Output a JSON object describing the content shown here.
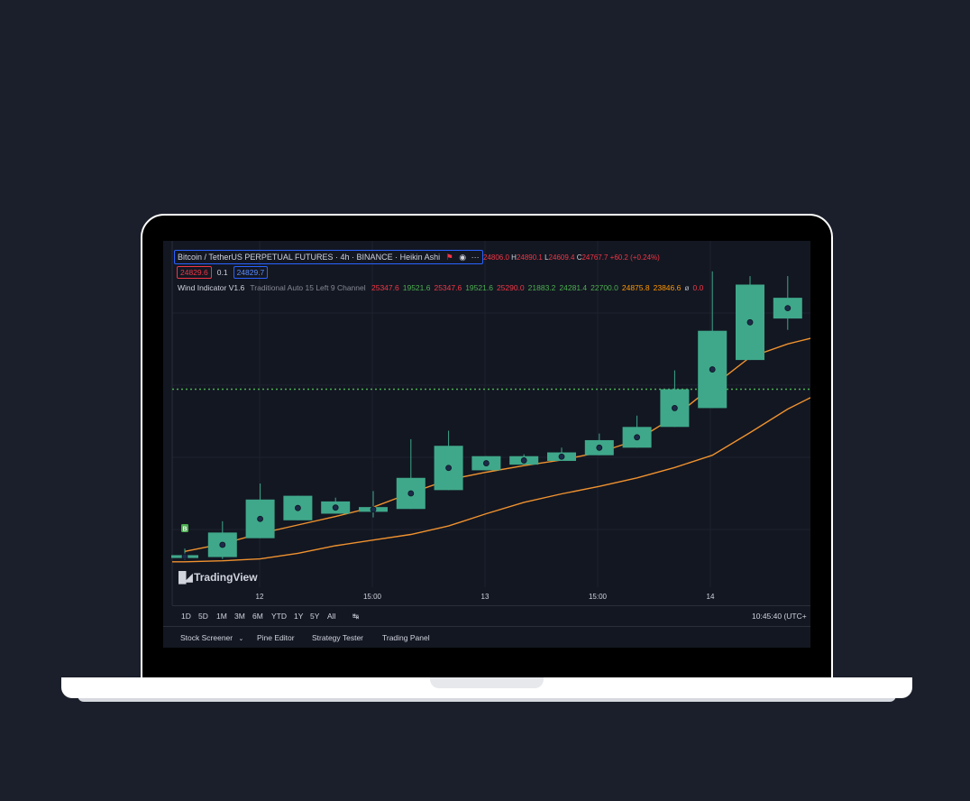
{
  "symbol_title": "Bitcoin / TetherUS PERPETUAL FUTURES · 4h · BINANCE · Heikin Ashi",
  "ohlc": {
    "o_val": "24806.0",
    "h_label": "H",
    "h_val": "24890.1",
    "l_label": "L",
    "l_val": "24609.4",
    "c_label": "C",
    "c_val": "24767.7",
    "change": "+60.2 (+0.24%)"
  },
  "price_tags": {
    "sell": "24829.6",
    "spread": "0.1",
    "buy": "24829.7"
  },
  "indicator": {
    "name": "Wind Indicator V1.6",
    "params": "Traditional Auto 15 Left 9 Channel",
    "values": [
      {
        "text": "25347.6",
        "color": "#f23645"
      },
      {
        "text": "19521.6",
        "color": "#4caf50"
      },
      {
        "text": "25347.6",
        "color": "#f23645"
      },
      {
        "text": "19521.6",
        "color": "#4caf50"
      },
      {
        "text": "25290.0",
        "color": "#f23645"
      },
      {
        "text": "21883.2",
        "color": "#4caf50"
      },
      {
        "text": "24281.4",
        "color": "#4caf50"
      },
      {
        "text": "22700.0",
        "color": "#4caf50"
      },
      {
        "text": "24875.8",
        "color": "#ff9800"
      },
      {
        "text": "23846.6",
        "color": "#ff9800"
      },
      {
        "text": "ø",
        "color": "#b2b5be"
      },
      {
        "text": "0.0",
        "color": "#f23645"
      }
    ]
  },
  "watermark": "TradingView",
  "buy_marker": "B",
  "x_axis_labels": [
    "12",
    "15:00",
    "13",
    "15:00",
    "14"
  ],
  "timeframes": [
    "1D",
    "5D",
    "1M",
    "3M",
    "6M",
    "YTD",
    "1Y",
    "5Y",
    "All"
  ],
  "clock": "10:45:40 (UTC+",
  "bottom_tabs": [
    "Stock Screener",
    "Pine Editor",
    "Strategy Tester",
    "Trading Panel"
  ],
  "colors": {
    "background": "#131722",
    "candle_up": "#3fa88a",
    "orange_line": "#f0922f",
    "green_dotted": "#4caf50",
    "grid": "#1e222d"
  },
  "chart_data": {
    "type": "candlestick",
    "style": "Heikin Ashi",
    "x_ticks": [
      "12",
      "15:00",
      "13",
      "15:00",
      "14"
    ],
    "candles": [
      {
        "open": 23610,
        "close": 23640,
        "high": 23710,
        "low": 23590
      },
      {
        "open": 23620,
        "close": 23880,
        "high": 24000,
        "low": 23600
      },
      {
        "open": 23820,
        "close": 24230,
        "high": 24400,
        "low": 23820
      },
      {
        "open": 24010,
        "close": 24270,
        "high": 24270,
        "low": 24010
      },
      {
        "open": 24080,
        "close": 24210,
        "high": 24250,
        "low": 24080
      },
      {
        "open": 24100,
        "close": 24150,
        "high": 24320,
        "low": 24040
      },
      {
        "open": 24130,
        "close": 24460,
        "high": 24870,
        "low": 24130
      },
      {
        "open": 24330,
        "close": 24800,
        "high": 24960,
        "low": 24330
      },
      {
        "open": 24540,
        "close": 24690,
        "high": 24690,
        "low": 24540
      },
      {
        "open": 24600,
        "close": 24690,
        "high": 24710,
        "low": 24600
      },
      {
        "open": 24640,
        "close": 24730,
        "high": 24780,
        "low": 24640
      },
      {
        "open": 24700,
        "close": 24860,
        "high": 24930,
        "low": 24700
      },
      {
        "open": 24780,
        "close": 25000,
        "high": 25120,
        "low": 24780
      },
      {
        "open": 25000,
        "close": 25400,
        "high": 25600,
        "low": 25000
      },
      {
        "open": 25200,
        "close": 26020,
        "high": 26650,
        "low": 25200
      },
      {
        "open": 25710,
        "close": 26510,
        "high": 26600,
        "low": 25710
      },
      {
        "open": 26150,
        "close": 26370,
        "high": 26600,
        "low": 26030
      }
    ],
    "upper_line": [
      23680,
      23760,
      23870,
      23960,
      24050,
      24150,
      24300,
      24440,
      24520,
      24590,
      24650,
      24730,
      24860,
      25110,
      25430,
      25740,
      25880
    ],
    "lower_line": [
      23570,
      23580,
      23600,
      23660,
      23740,
      23800,
      23860,
      23950,
      24080,
      24200,
      24290,
      24370,
      24460,
      24570,
      24700,
      24940,
      25190
    ],
    "dotted_level": 25400,
    "ylim": [
      23300,
      26840
    ]
  }
}
